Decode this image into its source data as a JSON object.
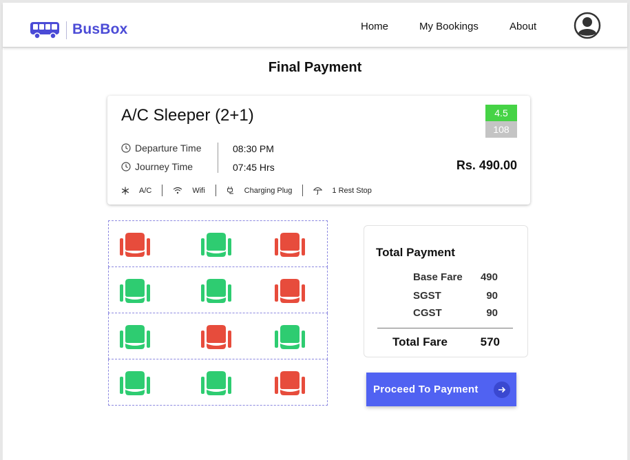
{
  "header": {
    "brand": "BusBox",
    "nav": {
      "home": "Home",
      "bookings": "My Bookings",
      "about": "About"
    }
  },
  "page_title": "Final Payment",
  "bus": {
    "type": "A/C Sleeper (2+1)",
    "rating": "4.5",
    "reviews": "108",
    "departure_label": "Departure Time",
    "departure_value": "08:30 PM",
    "journey_label": "Journey Time",
    "journey_value": "07:45 Hrs",
    "price": "Rs. 490.00",
    "amenities": [
      "A/C",
      "Wifi",
      "Charging Plug",
      "1 Rest Stop"
    ]
  },
  "seats": [
    [
      "booked",
      "available",
      "booked"
    ],
    [
      "available",
      "available",
      "booked"
    ],
    [
      "available",
      "booked",
      "available"
    ],
    [
      "available",
      "available",
      "booked"
    ]
  ],
  "summary": {
    "title": "Total Payment",
    "rows": [
      {
        "label": "Base Fare",
        "value": "490"
      },
      {
        "label": "SGST",
        "value": "90"
      },
      {
        "label": "CGST",
        "value": "90"
      }
    ],
    "total_label": "Total Fare",
    "total_value": "570"
  },
  "proceed_label": "Proceed To Payment",
  "colors": {
    "brand": "#4b4bd6",
    "seat_available": "#2ecc71",
    "seat_booked": "#e74c3c",
    "rating_bg": "#46d346",
    "button": "#5062f2"
  }
}
